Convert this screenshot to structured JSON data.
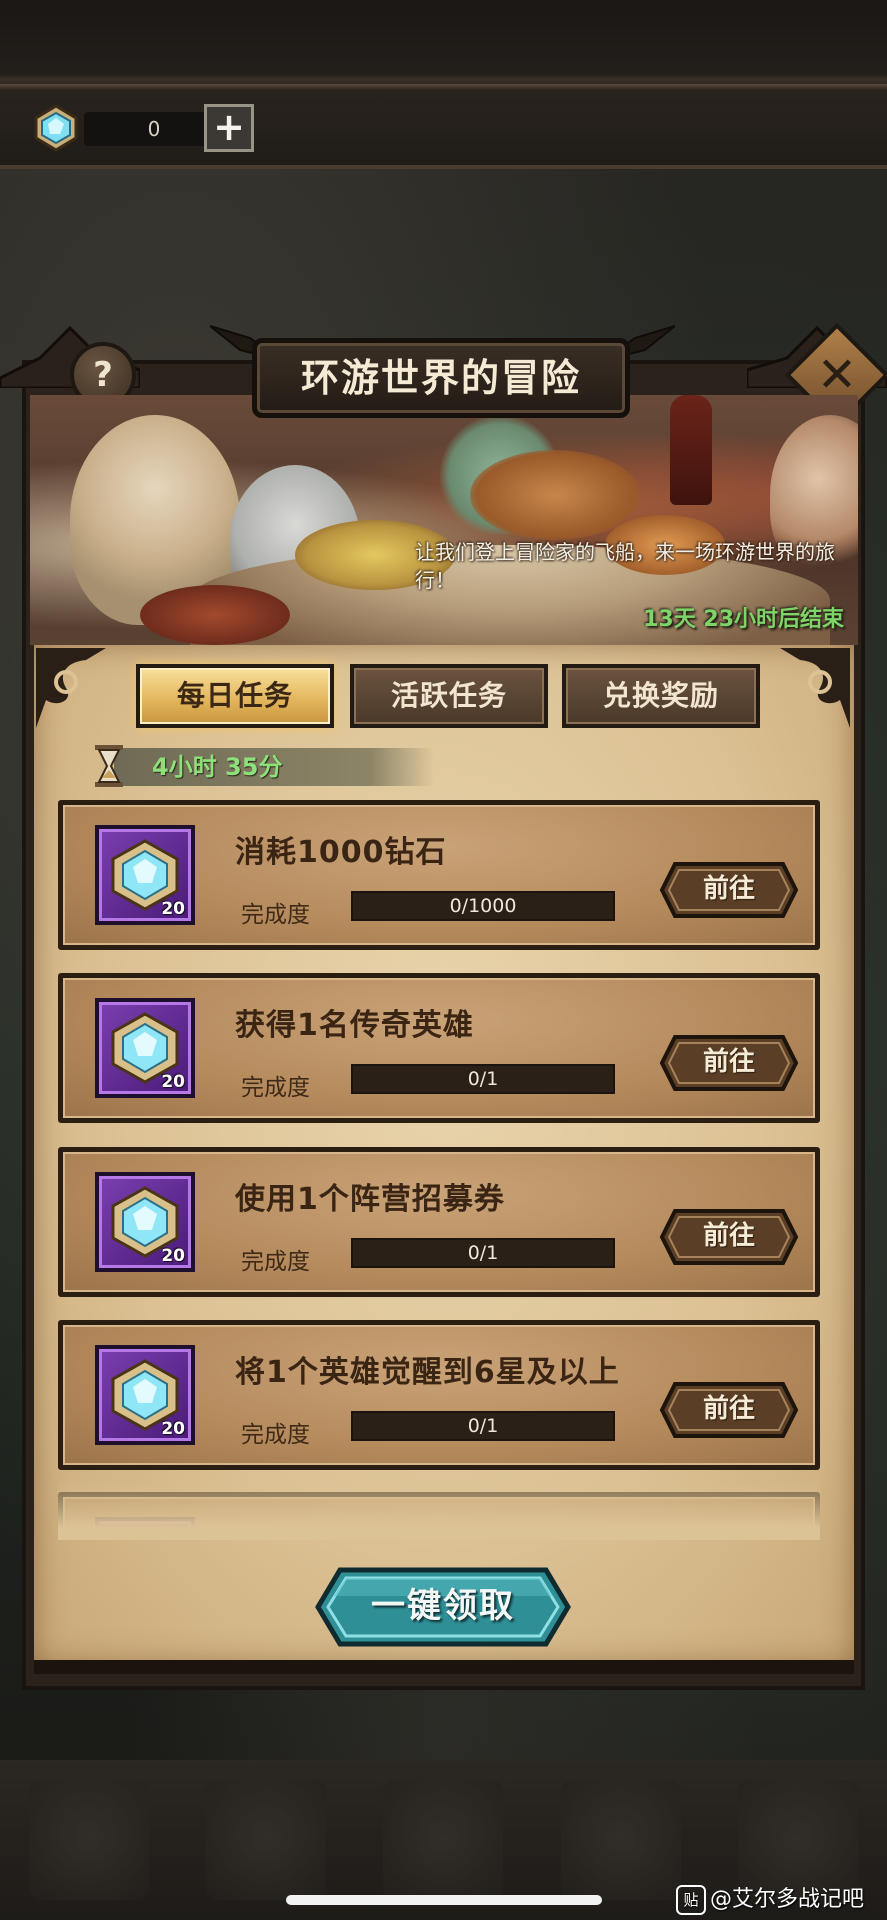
{
  "currency": {
    "amount": "0",
    "plus_symbol": "+"
  },
  "panel": {
    "title": "环游世界的冒险",
    "help_symbol": "?",
    "close_symbol": "✕"
  },
  "banner": {
    "description": "让我们登上冒险家的飞船，来一场环游世界的旅行！",
    "countdown": "13天 23小时后结束"
  },
  "tabs": [
    {
      "label": "每日任务",
      "active": true
    },
    {
      "label": "活跃任务",
      "active": false
    },
    {
      "label": "兑换奖励",
      "active": false
    }
  ],
  "timer": {
    "text": "4小时 35分",
    "icon": "hourglass-icon"
  },
  "tasks": [
    {
      "title": "消耗1000钻石",
      "reward_icon": "diamond-icon",
      "reward_qty": "20",
      "progress_label": "完成度",
      "progress_text": "0/1000",
      "progress": 0,
      "go_label": "前往"
    },
    {
      "title": "获得1名传奇英雄",
      "reward_icon": "diamond-icon",
      "reward_qty": "20",
      "progress_label": "完成度",
      "progress_text": "0/1",
      "progress": 0,
      "go_label": "前往"
    },
    {
      "title": "使用1个阵营招募券",
      "reward_icon": "diamond-icon",
      "reward_qty": "20",
      "progress_label": "完成度",
      "progress_text": "0/1",
      "progress": 0,
      "go_label": "前往"
    },
    {
      "title": "将1个英雄觉醒到6星及以上",
      "reward_icon": "diamond-icon",
      "reward_qty": "20",
      "progress_label": "完成度",
      "progress_text": "0/1",
      "progress": 0,
      "go_label": "前往"
    }
  ],
  "claim_all_label": "一键领取",
  "watermark": {
    "logo": "贴",
    "text": "@艾尔多战记吧"
  },
  "colors": {
    "active_tab": "#e2b45a",
    "countdown_green": "#7fd468",
    "reward_purple": "#7a3fb0",
    "claim_teal": "#2f8f96"
  }
}
